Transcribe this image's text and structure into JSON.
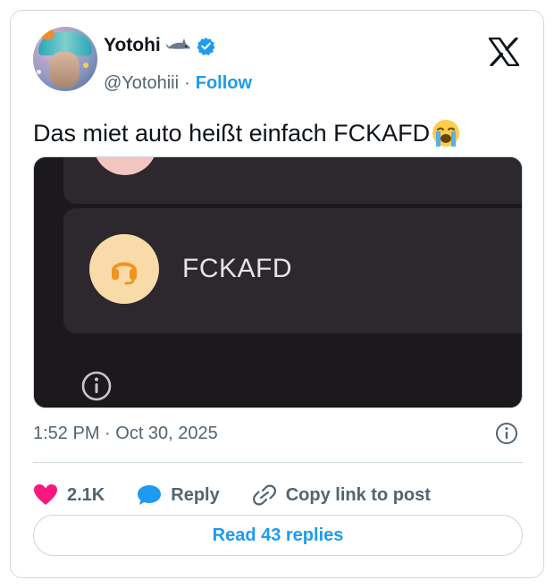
{
  "user": {
    "display_name": "Yotohi",
    "handle": "@Yotohiii",
    "separator": "·",
    "follow_label": "Follow"
  },
  "tweet": {
    "text": "Das miet auto heißt einfach FCKAFD"
  },
  "media": {
    "plate_text": "FCKAFD"
  },
  "meta": {
    "timestamp": "1:52 PM · Oct 30, 2025"
  },
  "actions": {
    "likes": "2.1K",
    "reply_label": "Reply",
    "copy_link_label": "Copy link to post"
  },
  "read_replies_label": "Read 43 replies",
  "colors": {
    "accent": "#1d9bf0",
    "heart": "#f91880",
    "muted": "#536471",
    "text": "#0f1419"
  },
  "icons": [
    "shark-icon",
    "verified-icon",
    "x-logo-icon",
    "crying-face-icon",
    "headset-icon",
    "info-icon",
    "heart-icon",
    "reply-bubble-icon",
    "link-icon"
  ]
}
